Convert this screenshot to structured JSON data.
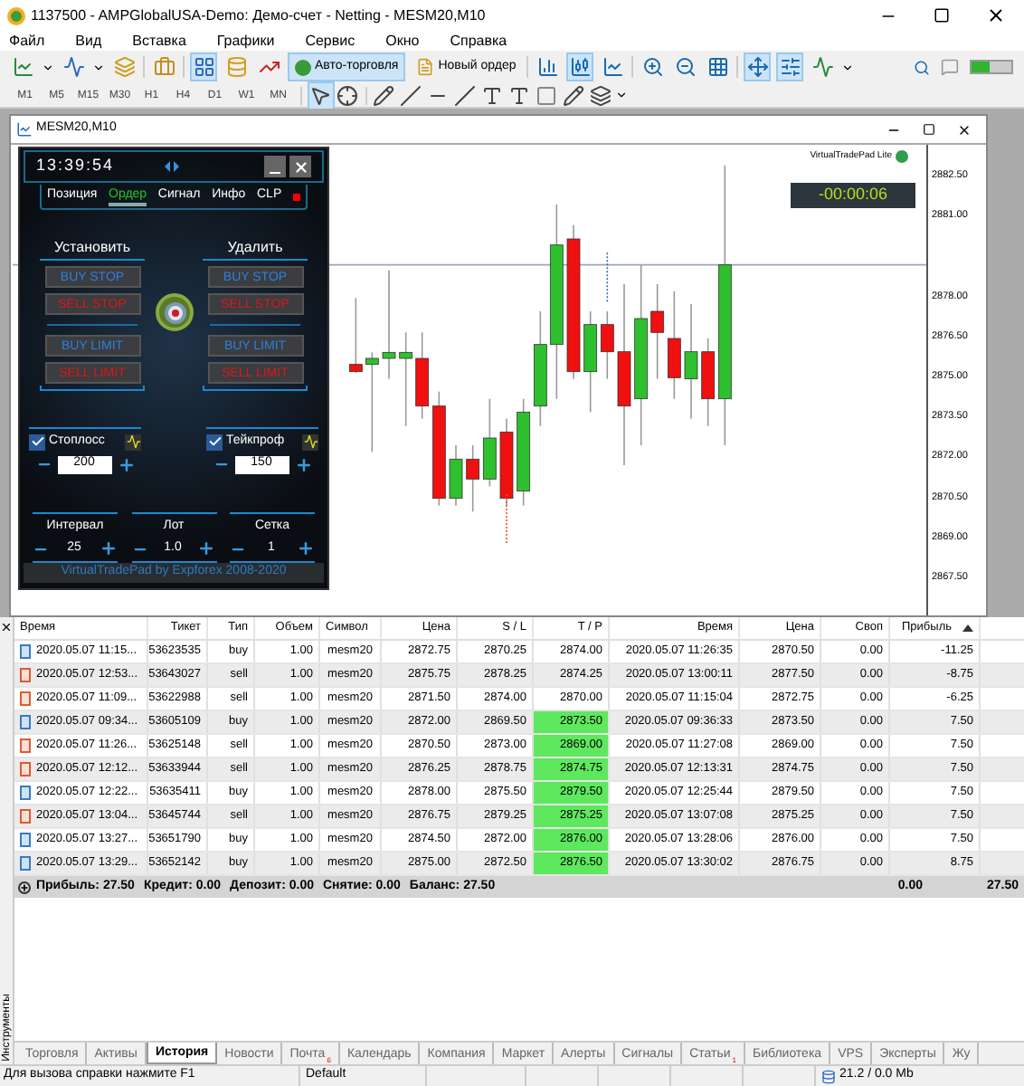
{
  "window": {
    "title": "1137500 - AMPGlobalUSA-Demo: Демо-счет - Netting - MESM20,M10"
  },
  "menu": [
    "Файл",
    "Вид",
    "Вставка",
    "Графики",
    "Сервис",
    "Окно",
    "Справка"
  ],
  "toolbar": {
    "auto_trading": {
      "label": "Авто-торговля",
      "on": true
    },
    "new_order": "Новый ордер"
  },
  "timeframes": [
    "M1",
    "M5",
    "M15",
    "M30",
    "H1",
    "H4",
    "D1",
    "W1",
    "MN"
  ],
  "chart": {
    "title": "MESM20,M10",
    "indicator_label": "VirtualTradePad Lite",
    "countdown": "-00:00:06",
    "price_axis": [
      "2882.50",
      "2881.00",
      "2878.00",
      "2876.50",
      "2875.00",
      "2873.50",
      "2872.00",
      "2870.50",
      "2869.00",
      "2867.50"
    ]
  },
  "trade_pad": {
    "clock": "13:39:54",
    "tabs": [
      {
        "label": "Позиция",
        "selected": false
      },
      {
        "label": "Ордер",
        "selected": true
      },
      {
        "label": "Сигнал",
        "selected": false
      },
      {
        "label": "Инфо",
        "selected": false
      },
      {
        "label": "CLP",
        "selected": false
      }
    ],
    "place_title": "Установить",
    "delete_title": "Удалить",
    "place_buttons": [
      {
        "label": "BUY STOP",
        "kind": "buy"
      },
      {
        "label": "SELL STOP",
        "kind": "sell"
      },
      {
        "label": "BUY LIMIT",
        "kind": "buy"
      },
      {
        "label": "SELL LIMIT",
        "kind": "sell"
      }
    ],
    "delete_buttons": [
      {
        "label": "BUY STOP",
        "kind": "buy"
      },
      {
        "label": "SELL STOP",
        "kind": "sell"
      },
      {
        "label": "BUY LIMIT",
        "kind": "buy"
      },
      {
        "label": "SELL LIMIT",
        "kind": "sell"
      }
    ],
    "stops": [
      {
        "label": "Стоплосс",
        "checked": true,
        "value": "200"
      },
      {
        "label": "Тейкпроф",
        "checked": true,
        "value": "150"
      }
    ],
    "steppers": [
      {
        "label": "Интервал",
        "value": "25"
      },
      {
        "label": "Лот",
        "value": "1.0"
      },
      {
        "label": "Сетка",
        "value": "1"
      }
    ],
    "footer": "VirtualTradePad by Expforex 2008-2020"
  },
  "table": {
    "columns": [
      {
        "label": "Время",
        "sorted": false
      },
      {
        "label": "Тикет",
        "sorted": false
      },
      {
        "label": "Тип",
        "sorted": false
      },
      {
        "label": "Объем",
        "sorted": false
      },
      {
        "label": "Символ",
        "sorted": false
      },
      {
        "label": "Цена",
        "sorted": false
      },
      {
        "label": "S / L",
        "sorted": false
      },
      {
        "label": "T / P",
        "sorted": false
      },
      {
        "label": "Время",
        "sorted": false
      },
      {
        "label": "Цена",
        "sorted": false
      },
      {
        "label": "Своп",
        "sorted": false
      },
      {
        "label": "Прибыль",
        "sorted": true
      }
    ],
    "rows": [
      {
        "kind": "buy",
        "tp_hit": false,
        "cells": [
          "2020.05.07 11:15...",
          "53623535",
          "buy",
          "1.00",
          "mesm20",
          "2872.75",
          "2870.25",
          "2874.00",
          "2020.05.07 11:26:35",
          "2870.50",
          "0.00",
          "-11.25"
        ]
      },
      {
        "kind": "sell",
        "tp_hit": false,
        "cells": [
          "2020.05.07 12:53...",
          "53643027",
          "sell",
          "1.00",
          "mesm20",
          "2875.75",
          "2878.25",
          "2874.25",
          "2020.05.07 13:00:11",
          "2877.50",
          "0.00",
          "-8.75"
        ]
      },
      {
        "kind": "sell",
        "tp_hit": false,
        "cells": [
          "2020.05.07 11:09...",
          "53622988",
          "sell",
          "1.00",
          "mesm20",
          "2871.50",
          "2874.00",
          "2870.00",
          "2020.05.07 11:15:04",
          "2872.75",
          "0.00",
          "-6.25"
        ]
      },
      {
        "kind": "buy",
        "tp_hit": true,
        "cells": [
          "2020.05.07 09:34...",
          "53605109",
          "buy",
          "1.00",
          "mesm20",
          "2872.00",
          "2869.50",
          "2873.50",
          "2020.05.07 09:36:33",
          "2873.50",
          "0.00",
          "7.50"
        ]
      },
      {
        "kind": "sell",
        "tp_hit": true,
        "cells": [
          "2020.05.07 11:26...",
          "53625148",
          "sell",
          "1.00",
          "mesm20",
          "2870.50",
          "2873.00",
          "2869.00",
          "2020.05.07 11:27:08",
          "2869.00",
          "0.00",
          "7.50"
        ]
      },
      {
        "kind": "sell",
        "tp_hit": true,
        "cells": [
          "2020.05.07 12:12...",
          "53633944",
          "sell",
          "1.00",
          "mesm20",
          "2876.25",
          "2878.75",
          "2874.75",
          "2020.05.07 12:13:31",
          "2874.75",
          "0.00",
          "7.50"
        ]
      },
      {
        "kind": "buy",
        "tp_hit": true,
        "cells": [
          "2020.05.07 12:22...",
          "53635411",
          "buy",
          "1.00",
          "mesm20",
          "2878.00",
          "2875.50",
          "2879.50",
          "2020.05.07 12:25:44",
          "2879.50",
          "0.00",
          "7.50"
        ]
      },
      {
        "kind": "sell",
        "tp_hit": true,
        "cells": [
          "2020.05.07 13:04...",
          "53645744",
          "sell",
          "1.00",
          "mesm20",
          "2876.75",
          "2879.25",
          "2875.25",
          "2020.05.07 13:07:08",
          "2875.25",
          "0.00",
          "7.50"
        ]
      },
      {
        "kind": "buy",
        "tp_hit": true,
        "cells": [
          "2020.05.07 13:27...",
          "53651790",
          "buy",
          "1.00",
          "mesm20",
          "2874.50",
          "2872.00",
          "2876.00",
          "2020.05.07 13:28:06",
          "2876.00",
          "0.00",
          "7.50"
        ]
      },
      {
        "kind": "buy",
        "tp_hit": true,
        "cells": [
          "2020.05.07 13:29...",
          "53652142",
          "buy",
          "1.00",
          "mesm20",
          "2875.00",
          "2872.50",
          "2876.50",
          "2020.05.07 13:30:02",
          "2876.75",
          "0.00",
          "8.75"
        ]
      }
    ],
    "summary": {
      "items": [
        "Прибыль: 27.50",
        "Кредит: 0.00",
        "Депозит: 0.00",
        "Снятие: 0.00",
        "Баланс: 27.50"
      ],
      "swap": "0.00",
      "profit": "27.50"
    }
  },
  "side_label": "Инструменты",
  "bottom_tabs": [
    {
      "label": "Торговля",
      "selected": false
    },
    {
      "label": "Активы",
      "selected": false
    },
    {
      "label": "История",
      "selected": true
    },
    {
      "label": "Новости",
      "selected": false
    },
    {
      "label": "Почта",
      "selected": false,
      "badge": "6"
    },
    {
      "label": "Календарь",
      "selected": false
    },
    {
      "label": "Компания",
      "selected": false
    },
    {
      "label": "Маркет",
      "selected": false
    },
    {
      "label": "Алерты",
      "selected": false
    },
    {
      "label": "Сигналы",
      "selected": false
    },
    {
      "label": "Статьи",
      "selected": false,
      "badge": "1"
    },
    {
      "label": "Библиотека",
      "selected": false
    },
    {
      "label": "VPS",
      "selected": false
    },
    {
      "label": "Эксперты",
      "selected": false
    },
    {
      "label": "Жу",
      "selected": false
    }
  ],
  "status_bar": {
    "help": "Для вызова справки нажмите F1",
    "profile": "Default",
    "traffic": "21.2 / 0.0 Mb"
  }
}
